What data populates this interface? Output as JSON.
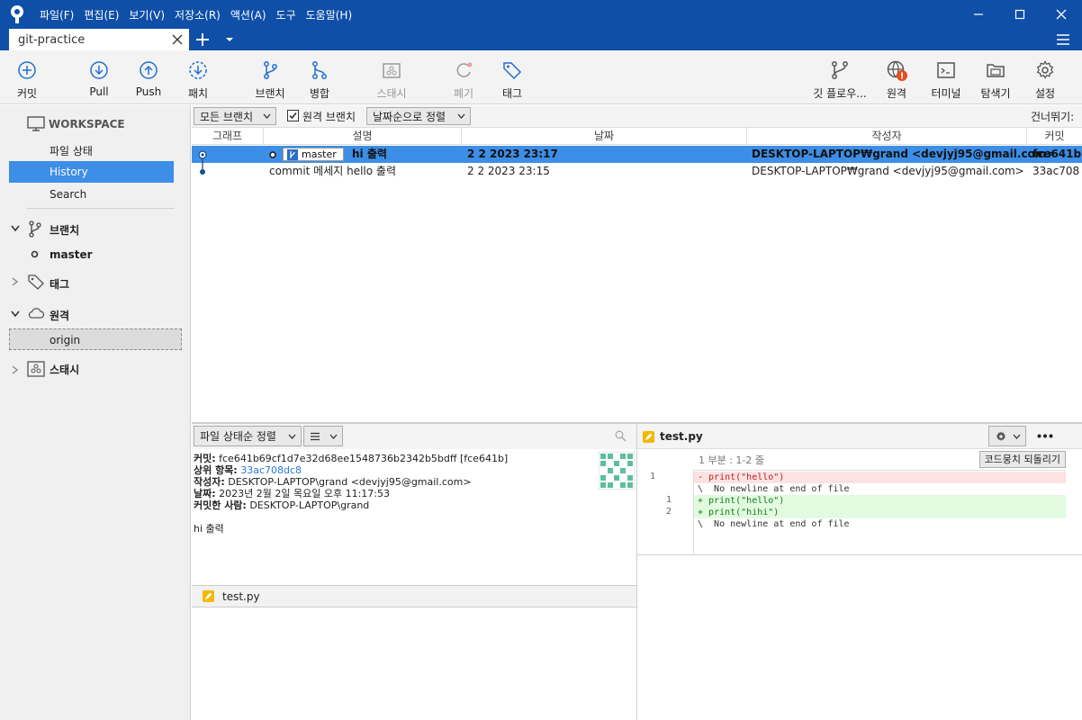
{
  "colors": {
    "titlebar": "#0f4fa8",
    "selection": "#3d8ee6",
    "removed": "#fde2e2",
    "added": "#e2fbe0",
    "badge": "#e74c1c"
  },
  "menu": [
    "파일(F)",
    "편집(E)",
    "보기(V)",
    "저장소(R)",
    "액션(A)",
    "도구",
    "도움말(H)"
  ],
  "tab": {
    "title": "git-practice"
  },
  "toolbar": {
    "commit": "커밋",
    "pull": "Pull",
    "push": "Push",
    "fetch": "패치",
    "branch": "브랜치",
    "merge": "병합",
    "stash": "스태시",
    "discard": "폐기",
    "tag": "태그",
    "gitflow": "깃 플로우...",
    "remote": "원격",
    "terminal": "터미널",
    "explorer": "탐색기",
    "settings": "설정"
  },
  "sidebar": {
    "workspace": "WORKSPACE",
    "file_status": "파일 상태",
    "history": "History",
    "search": "Search",
    "branches": "브랜치",
    "branch_master": "master",
    "tags": "태그",
    "remotes": "원격",
    "remote_origin": "origin",
    "stashes": "스태시"
  },
  "filters": {
    "all_branches": "모든 브랜치",
    "show_remote": "원격 브랜치",
    "sort": "날짜순으로 정렬",
    "jump_to": "건너뛰기:"
  },
  "columns": {
    "graph": "그래프",
    "description": "설명",
    "date": "날짜",
    "author": "작성자",
    "commit": "커밋"
  },
  "commits": [
    {
      "branch": "master",
      "message": "hi 출력",
      "date": "2 2 2023 23:17",
      "author": "DESKTOP-LAPTOP₩grand <devjyj95@gmail.com>",
      "hash": "fce641b"
    },
    {
      "message": "commit 메세지 hello 출력",
      "date": "2 2 2023 23:15",
      "author": "DESKTOP-LAPTOP₩grand <devjyj95@gmail.com>",
      "hash": "33ac708"
    }
  ],
  "lower": {
    "sort_by_status": "파일 상태순 정렬"
  },
  "details": {
    "commit_label": "커밋:",
    "commit_value": "fce641b69cf1d7e32d68ee1548736b2342b5bdff [fce641b]",
    "parent_label": "상위 항목:",
    "parent_value": "33ac708dc8",
    "author_label": "작성자:",
    "author_value": "DESKTOP-LAPTOP\\grand <devjyj95@gmail.com>",
    "date_label": "날짜:",
    "date_value": "2023년 2월 2일 목요일 오후 11:17:53",
    "committer_label": "커밋한 사람:",
    "committer_value": "DESKTOP-LAPTOP\\grand",
    "message": "hi 출력"
  },
  "files": [
    "test.py"
  ],
  "diff": {
    "file": "test.py",
    "hunk": "1 부분 : 1-2 줄",
    "revert": "코드뭉치 되돌리기",
    "lines": [
      {
        "old": "1",
        "new": "",
        "text": "- print(\"hello\")",
        "kind": "removed"
      },
      {
        "old": "",
        "new": "",
        "text": "\\  No newline at end of file",
        "kind": "meta"
      },
      {
        "old": "",
        "new": "1",
        "text": "+ print(\"hello\")",
        "kind": "added"
      },
      {
        "old": "",
        "new": "2",
        "text": "+ print(\"hihi\")",
        "kind": "added"
      },
      {
        "old": "",
        "new": "",
        "text": "\\  No newline at end of file",
        "kind": "meta"
      }
    ]
  }
}
